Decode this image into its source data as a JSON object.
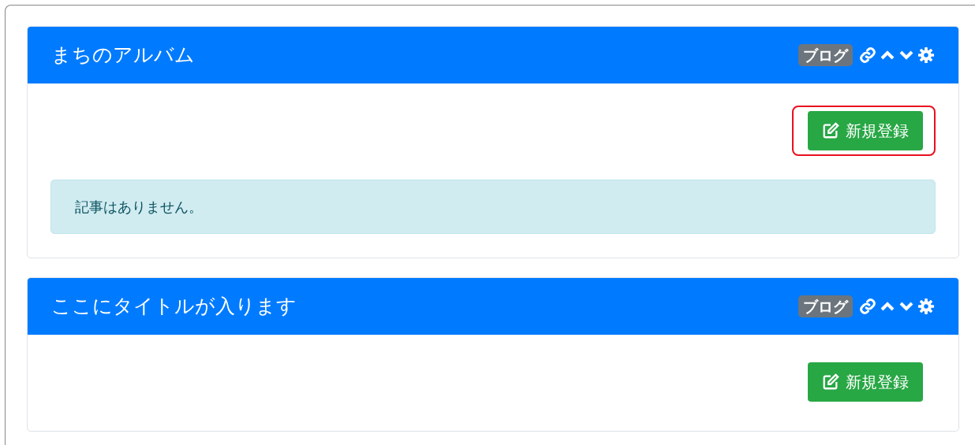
{
  "panels": [
    {
      "title": "まちのアルバム",
      "badge": "ブログ",
      "button": "新規登録",
      "highlighted": true,
      "alert": "記事はありません。"
    },
    {
      "title": "ここにタイトルが入ります",
      "badge": "ブログ",
      "button": "新規登録",
      "highlighted": false
    }
  ]
}
